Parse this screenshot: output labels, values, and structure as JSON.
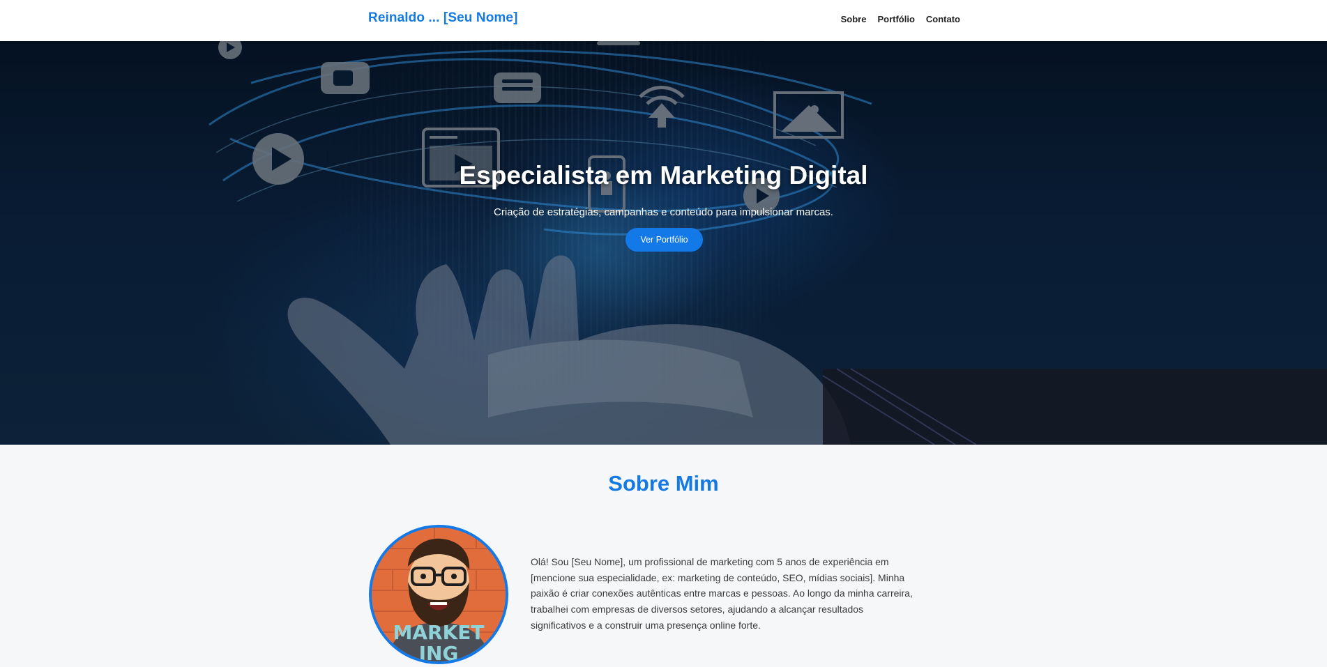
{
  "header": {
    "brand": "Reinaldo ... [Seu Nome]",
    "nav": [
      "Sobre",
      "Portfólio",
      "Contato"
    ]
  },
  "hero": {
    "title": "Especialista em Marketing Digital",
    "subtitle": "Criação de estratégias, campanhas e conteúdo para impulsionar marcas.",
    "cta_label": "Ver Portfólio"
  },
  "about": {
    "title": "Sobre Mim",
    "shirt_text": "MARKET\nING",
    "body": "Olá! Sou [Seu Nome], um profissional de marketing com 5 anos de experiência em [mencione sua especialidade, ex: marketing de conteúdo, SEO, mídias sociais]. Minha paixão é criar conexões autênticas entre marcas e pessoas. Ao longo da minha carreira, trabalhei com empresas de diversos setores, ajudando a alcançar resultados significativos e a construir uma presença online forte."
  },
  "colors": {
    "accent": "#1479e0",
    "button": "#1479e8",
    "page_bg": "#f6f7f9",
    "header_bg": "#ffffff"
  }
}
